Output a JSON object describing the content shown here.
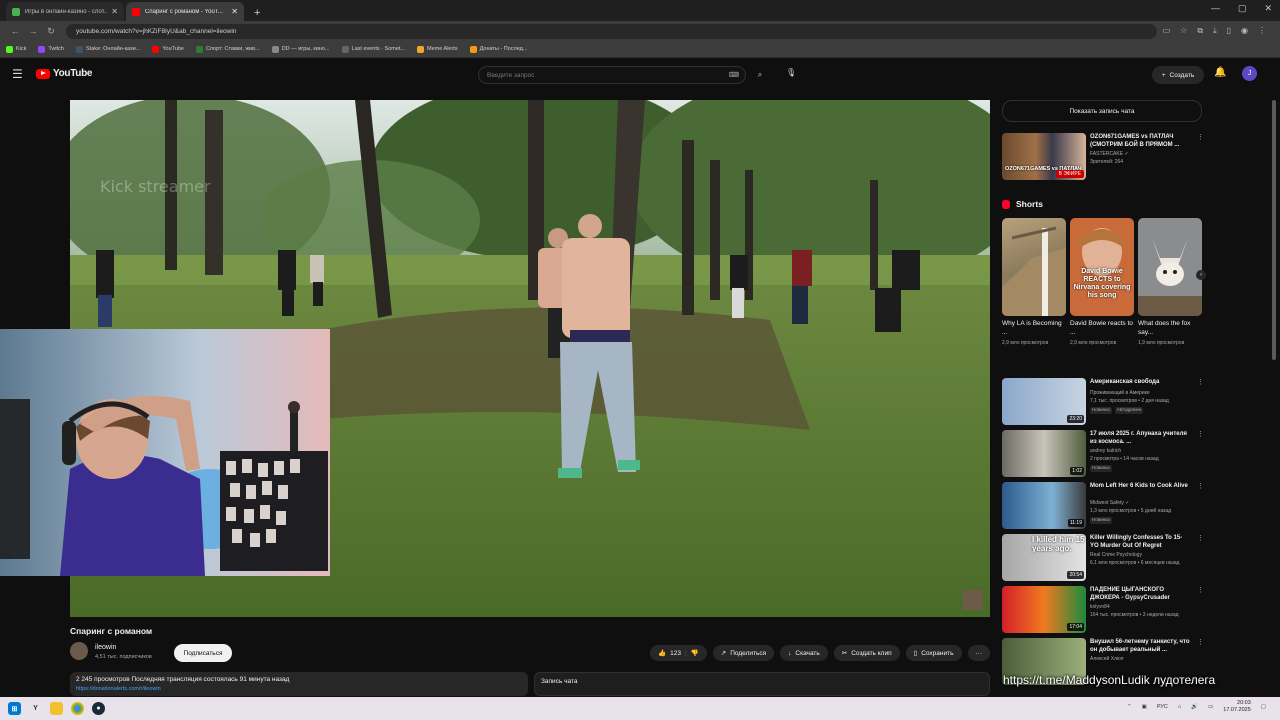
{
  "browser": {
    "tabs": [
      {
        "label": "Игры в онлайн-казино - слот...",
        "favicon_color": "#4caf50",
        "active": false
      },
      {
        "label": "Спаринг с романом - YouT...",
        "favicon_color": "#ff0000",
        "active": true
      }
    ],
    "new_tab": "+",
    "window_controls": [
      "—",
      "▢",
      "✕"
    ],
    "url": "youtube.com/watch?v=jhKZiF8IyU&ab_channel=ileowin",
    "bookmarks": [
      {
        "label": "Kick",
        "color": "#53fc18"
      },
      {
        "label": "Twitch",
        "color": "#9146ff"
      },
      {
        "label": "Stake: Онлайн-кази...",
        "color": "#1a2c38"
      },
      {
        "label": "YouTube",
        "color": "#ff0000"
      },
      {
        "label": "Спорт: Ставки, жив...",
        "color": "#2e7d32"
      },
      {
        "label": "DD — игры, кино...",
        "color": "#888888"
      },
      {
        "label": "Last events · Somet...",
        "color": "#666666"
      },
      {
        "label": "Meme Alerts",
        "color": "#f5a623"
      },
      {
        "label": "Донаты - Послед...",
        "color": "#f39c12"
      }
    ]
  },
  "youtube": {
    "logo_text": "YouTube",
    "search_placeholder": "Введите запрос",
    "create_label": "Создать",
    "avatar_letter": "J"
  },
  "video": {
    "title": "Спаринг с романом",
    "channel_name": "ileowin",
    "channel_subs": "4,51 тыс. подписчиков",
    "subscribe_label": "Подписаться",
    "likes": "123",
    "share_label": "Поделиться",
    "download_label": "Скачать",
    "clip_label": "Создать клип",
    "save_label": "Сохранить",
    "more": "···",
    "description_line1": "2 245 просмотров  Последняя трансляция состоялась 91 минута назад",
    "description_line2": "https://donationalerts.com/r/ileowin",
    "chat_replay_label": "Запись чата",
    "player_watermark": "Kick streamer"
  },
  "sidebar": {
    "show_chat_label": "Показать запись чата",
    "live_item": {
      "title": "OZON671GAMES vs ПАТЛАЧ (СМОТРИМ БОЙ В ПРЯМОМ ...",
      "channel": "FASTERCAKE",
      "meta": "Зрителей: 264",
      "thumb_caption": "OZON671GAMES vs ПАТЛАЧ",
      "badge": "В ЭФИРЕ"
    },
    "shorts_heading": "Shorts",
    "shorts": [
      {
        "title": "Why LA is Becoming ...",
        "views": "2,9 млн просмотров"
      },
      {
        "title": "David Bowie reacts to ...",
        "views": "2,9 млн просмотров",
        "overlay": "David Bowie REACTS to Nirvana covering his song"
      },
      {
        "title": "What does the fox say...",
        "views": "1,9 млн просмотров"
      }
    ],
    "videos": [
      {
        "title": "Американская свобода",
        "channel": "Проживающий в Америке",
        "meta": "7,1 тыс. просмотров • 2 дня назад",
        "tags": [
          "Новинка",
          "Автодрянен"
        ],
        "duration": "23:20"
      },
      {
        "title": "17 июля 2025 г. Апунаха учителя из космоса. ...",
        "channel": "andrey kalrich",
        "meta": "2 просмотра • 14 часов назад",
        "tags": [
          "Новинка"
        ],
        "duration": "1:02"
      },
      {
        "title": "Mom Left Her 6 Kids to Cook Alive",
        "channel": "Midwest Safety",
        "meta": "1,3 млн просмотров • 5 дней назад",
        "tags": [
          "Новинка"
        ],
        "duration": "11:19"
      },
      {
        "title": "Killer Willingly Confesses To 15-YO Murder Out Of Regret",
        "channel": "Real Crime Psychology",
        "meta": "6,1 млн просмотров • 6 месяцев назад",
        "tags": [],
        "duration": "20:54",
        "overlay": "I killed him 15 years ago."
      },
      {
        "title": "ПАДЕНИЕ ЦЫГАНСКОГО ДЖОКЕРА - GypsyCrusader",
        "channel": "kolyvn84",
        "meta": "164 тыс. просмотров • 3 недели назад",
        "tags": [],
        "duration": "17:04"
      },
      {
        "title": "Внушил 56-летнему танкисту, что он добывает реальный ...",
        "channel": "Алексей Хлюп",
        "meta": "",
        "tags": [],
        "duration": ""
      }
    ]
  },
  "overlay_text": "https://t.me/MaddysonLudik лудотелега",
  "taskbar": {
    "tray_lang": "РУС",
    "time": "20:03",
    "date": "17.07.2025"
  }
}
